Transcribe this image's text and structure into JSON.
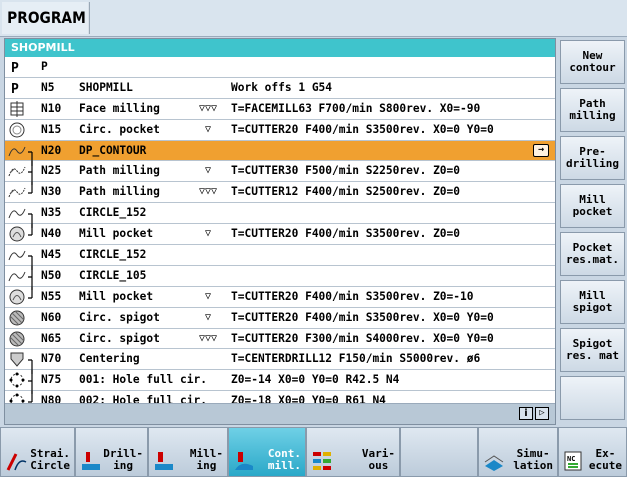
{
  "header": {
    "title": "PROGRAM"
  },
  "panel": {
    "title": "SHOPMILL",
    "info_icon": "info-icon",
    "next_icon": "page-forward-icon"
  },
  "rows": [
    {
      "icon": "program-header-icon",
      "bracket": "",
      "num": "P",
      "name": "",
      "depth": "",
      "params": ""
    },
    {
      "icon": "program-header-icon",
      "bracket": "",
      "num": "N5",
      "name": "SHOPMILL",
      "depth": "",
      "params": "Work offs 1 G54"
    },
    {
      "icon": "face-milling-icon",
      "bracket": "",
      "num": "N10",
      "name": "Face milling",
      "depth": "▽▽▽",
      "params": "T=FACEMILL63 F700/min S800rev. X0=-90"
    },
    {
      "icon": "circ-pocket-icon",
      "bracket": "",
      "num": "N15",
      "name": "Circ. pocket",
      "depth": "▽",
      "params": "T=CUTTER20 F400/min S3500rev. X0=0 Y0=0"
    },
    {
      "icon": "contour-icon",
      "bracket": "top",
      "num": "N20",
      "name": "DP_CONTOUR",
      "depth": "",
      "params": "",
      "selected": true
    },
    {
      "icon": "path-milling-icon",
      "bracket": "mid",
      "num": "N25",
      "name": "Path milling",
      "depth": "▽",
      "params": "T=CUTTER30 F500/min S2250rev. Z0=0"
    },
    {
      "icon": "path-milling-icon",
      "bracket": "bot",
      "num": "N30",
      "name": "Path milling",
      "depth": "▽▽▽",
      "params": "T=CUTTER12 F400/min S2500rev. Z0=0"
    },
    {
      "icon": "contour-icon",
      "bracket": "top",
      "num": "N35",
      "name": "CIRCLE_152",
      "depth": "",
      "params": ""
    },
    {
      "icon": "mill-pocket-icon",
      "bracket": "bot",
      "num": "N40",
      "name": "Mill pocket",
      "depth": "▽",
      "params": "T=CUTTER20 F400/min S3500rev. Z0=0"
    },
    {
      "icon": "contour-icon",
      "bracket": "top",
      "num": "N45",
      "name": "CIRCLE_152",
      "depth": "",
      "params": ""
    },
    {
      "icon": "contour-icon",
      "bracket": "mid",
      "num": "N50",
      "name": "CIRCLE_105",
      "depth": "",
      "params": ""
    },
    {
      "icon": "mill-pocket-icon",
      "bracket": "bot",
      "num": "N55",
      "name": "Mill pocket",
      "depth": "▽",
      "params": "T=CUTTER20 F400/min S3500rev. Z0=-10"
    },
    {
      "icon": "circ-spigot-icon",
      "bracket": "",
      "num": "N60",
      "name": "Circ. spigot",
      "depth": "▽",
      "params": "T=CUTTER20 F400/min S3500rev. X0=0 Y0=0"
    },
    {
      "icon": "circ-spigot-icon",
      "bracket": "",
      "num": "N65",
      "name": "Circ. spigot",
      "depth": "▽▽▽",
      "params": "T=CUTTER20 F300/min S4000rev. X0=0 Y0=0"
    },
    {
      "icon": "centering-icon",
      "bracket": "top",
      "num": "N70",
      "name": "Centering",
      "depth": "",
      "params": "T=CENTERDRILL12 F150/min S5000rev. ø6"
    },
    {
      "icon": "hole-circle-icon",
      "bracket": "mid",
      "num": "N75",
      "name": "001: Hole full cir.",
      "depth": "",
      "params": "Z0=-14 X0=0 Y0=0 R42.5 N4"
    },
    {
      "icon": "hole-circle-icon",
      "bracket": "bot",
      "num": "N80",
      "name": "002: Hole full cir.",
      "depth": "",
      "params": "Z0=-18 X0=0 Y0=0 R61 N4"
    },
    {
      "icon": "",
      "bracket": "",
      "num": "",
      "name": "",
      "depth": "",
      "params": ""
    }
  ],
  "softkeys_right": [
    {
      "label": "New\ncontour"
    },
    {
      "label": "Path\nmilling"
    },
    {
      "label": "Pre-\ndrilling"
    },
    {
      "label": "Mill\npocket"
    },
    {
      "label": "Pocket\nres.mat."
    },
    {
      "label": "Mill\nspigot"
    },
    {
      "label": "Spigot\nres. mat"
    },
    {
      "label": ""
    }
  ],
  "softkeys_bottom": [
    {
      "label": "Strai.\nCircle",
      "icon": "straight-circle-icon"
    },
    {
      "label": "Drill-\ning",
      "icon": "drilling-icon"
    },
    {
      "label": "Mill-\ning",
      "icon": "milling-icon"
    },
    {
      "label": "Cont.\nmill.",
      "icon": "contour-milling-icon",
      "active": true
    },
    {
      "label": "Vari-\nous",
      "icon": "various-icon"
    },
    {
      "label": "",
      "icon": ""
    },
    {
      "label": "Simu-\nlation",
      "icon": "simulation-icon"
    },
    {
      "label": "Ex-\necute",
      "icon": "nc-execute-icon"
    }
  ],
  "colors": {
    "header_teal": "#3fc4cc",
    "selected_orange": "#f0a030",
    "active_key": "#2aa8c8"
  }
}
